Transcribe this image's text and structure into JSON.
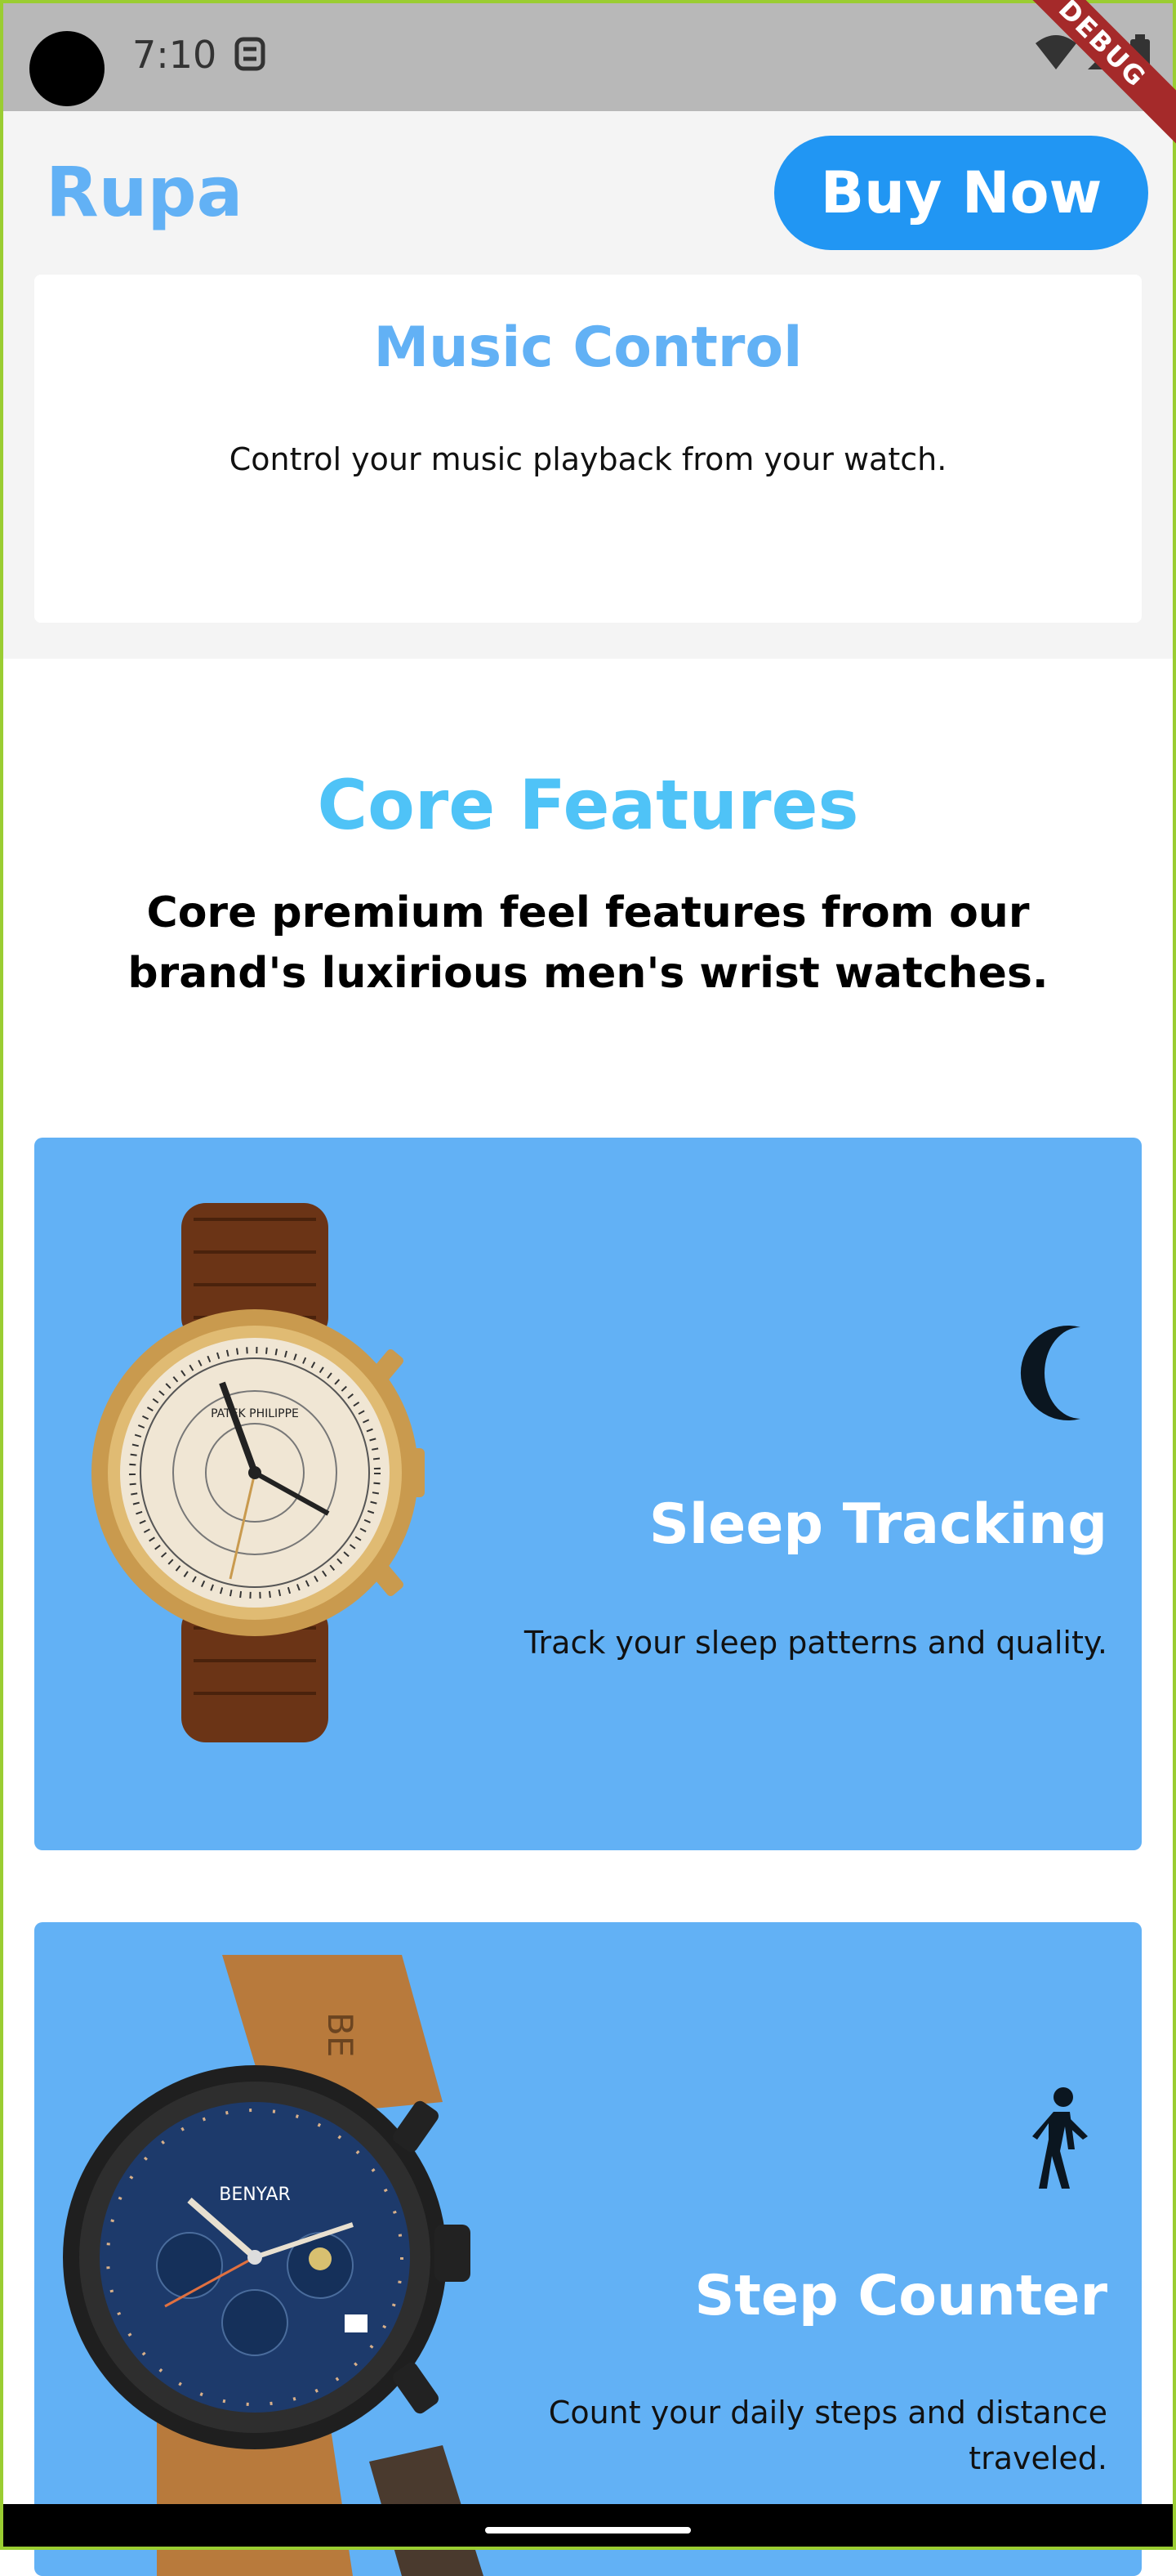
{
  "status_bar": {
    "time": "7:10",
    "debug_label": "DEBUG"
  },
  "app_bar": {
    "brand": "Rupa",
    "buy_button": "Buy Now"
  },
  "music_card": {
    "title": "Music Control",
    "description": "Control your music playback from your watch."
  },
  "core": {
    "title": "Core Features",
    "subtitle": "Core premium feel features from our brand's luxirious men's wrist watches."
  },
  "features": [
    {
      "title": "Sleep Tracking",
      "description": "Track your sleep patterns and quality.",
      "icon": "moon-icon"
    },
    {
      "title": "Step Counter",
      "description": "Count your daily steps and distance traveled.",
      "icon": "walking-person-icon"
    }
  ],
  "watch_brands": {
    "watch1_text": "PATEK PHILIPPE",
    "watch2_text": "BENYAR"
  },
  "colors": {
    "accent": "#62b1f5",
    "button": "#2196f3",
    "title_cyan": "#4fc3f7",
    "card_bg": "#62b1f5"
  }
}
